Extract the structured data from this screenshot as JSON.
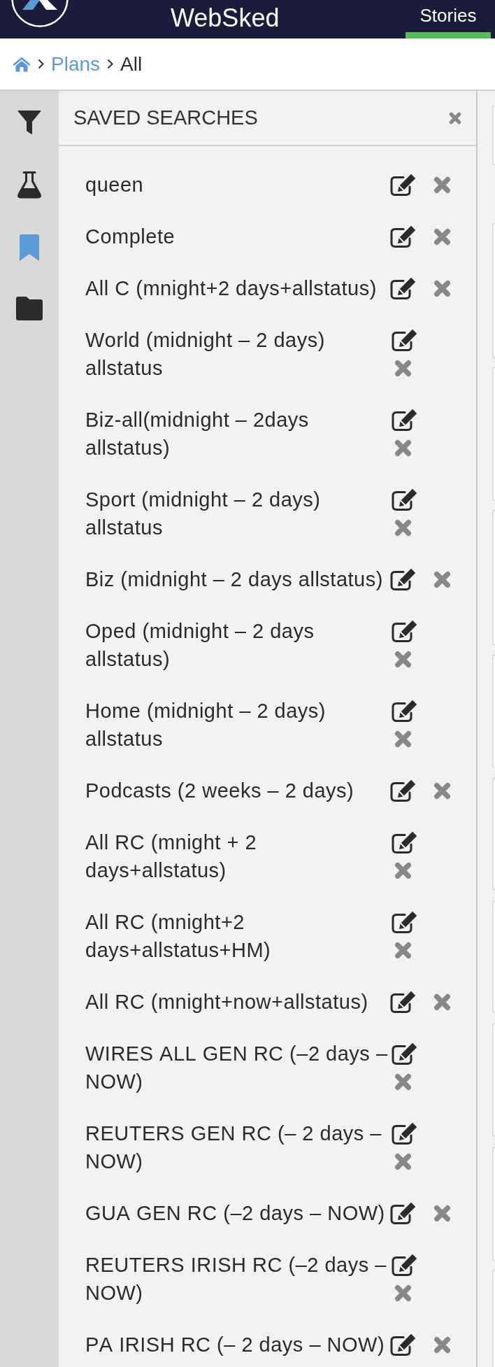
{
  "header": {
    "title": "WebSked",
    "tabs": [
      {
        "label": "Stories",
        "selected": true
      }
    ]
  },
  "breadcrumb": [
    {
      "kind": "home"
    },
    {
      "kind": "link",
      "label": "Plans"
    },
    {
      "kind": "current",
      "label": "All"
    }
  ],
  "rail": [
    {
      "kind": "filter",
      "selected": false
    },
    {
      "kind": "flask",
      "selected": false
    },
    {
      "kind": "bookmark",
      "selected": true
    },
    {
      "kind": "folder",
      "selected": false
    }
  ],
  "saved_searches": {
    "title": "SAVED SEARCHES",
    "items": [
      {
        "name": "queen"
      },
      {
        "name": "Complete"
      },
      {
        "name": "All C (mnight+2 days+allstatus)"
      },
      {
        "name": "World (midnight – 2 days) allstatus"
      },
      {
        "name": "Biz-all(midnight – 2days allstatus)"
      },
      {
        "name": "Sport (midnight – 2 days) allstatus"
      },
      {
        "name": "Biz (midnight – 2 days allstatus)"
      },
      {
        "name": "Oped (midnight – 2 days allstatus)"
      },
      {
        "name": "Home (midnight – 2 days) allstatus"
      },
      {
        "name": "Podcasts (2 weeks – 2 days)"
      },
      {
        "name": "All RC (mnight + 2 days+allstatus)"
      },
      {
        "name": "All RC (mnight+2 days+allstatus+HM)"
      },
      {
        "name": "All RC (mnight+now+allstatus)"
      },
      {
        "name": "WIRES ALL GEN RC (–2 days – NOW)"
      },
      {
        "name": "REUTERS GEN RC (– 2 days – NOW)"
      },
      {
        "name": "GUA GEN RC (–2 days – NOW)"
      },
      {
        "name": "REUTERS IRISH RC (–2 days – NOW)"
      },
      {
        "name": "PA IRISH RC (– 2 days – NOW)"
      }
    ]
  }
}
